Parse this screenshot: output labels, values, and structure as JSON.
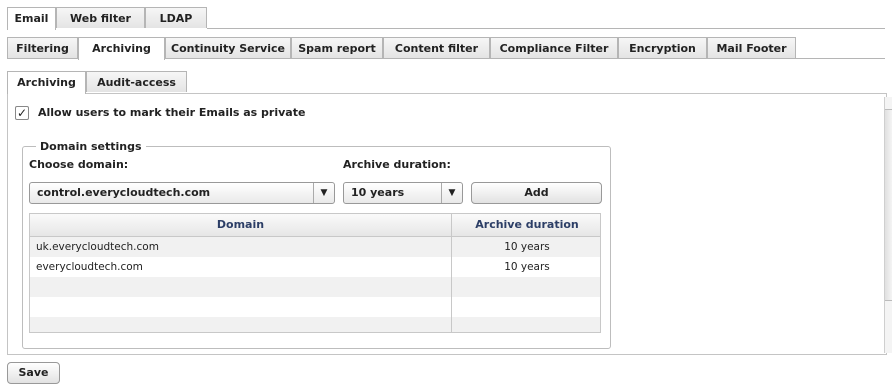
{
  "top_tabs": [
    "Email",
    "Web filter",
    "LDAP"
  ],
  "top_active": "Email",
  "second_tabs": [
    "Filtering",
    "Archiving",
    "Continuity Service",
    "Spam report",
    "Content filter",
    "Compliance Filter",
    "Encryption",
    "Mail Footer"
  ],
  "second_active": "Archiving",
  "third_tabs": [
    "Archiving",
    "Audit-access"
  ],
  "third_active": "Archiving",
  "private_checkbox": {
    "label": "Allow users to mark their Emails as private",
    "checked": true
  },
  "domain_settings": {
    "legend": "Domain settings",
    "choose_domain_label": "Choose domain:",
    "archive_duration_label": "Archive duration:",
    "domain_value": "control.everycloudtech.com",
    "duration_value": "10 years",
    "add_label": "Add"
  },
  "table": {
    "columns": [
      "Domain",
      "Archive duration"
    ],
    "rows": [
      {
        "domain": "uk.everycloudtech.com",
        "duration": "10 years"
      },
      {
        "domain": "everycloudtech.com",
        "duration": "10 years"
      }
    ]
  },
  "save_label": "Save"
}
